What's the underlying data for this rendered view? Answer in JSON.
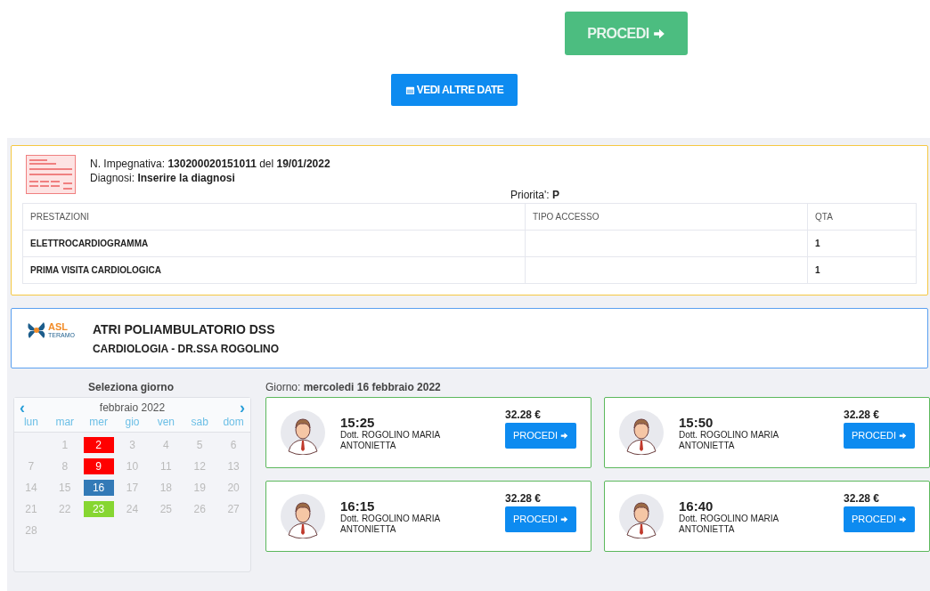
{
  "top_buttons": {
    "proceed": "PROCEDI",
    "other_dates": "VEDI ALTRE DATE"
  },
  "prescription": {
    "number_label": "N. Impegnativa:",
    "number": "130200020151011",
    "date_label": "del",
    "date": "19/01/2022",
    "diagnosis_label": "Diagnosi:",
    "diagnosis": "Inserire la diagnosi",
    "priority_label": "Priorita':",
    "priority": "P",
    "table": {
      "columns": [
        "PRESTAZIONI",
        "TIPO ACCESSO",
        "QTA"
      ],
      "rows": [
        [
          "ELETTROCARDIOGRAMMA",
          "",
          "1"
        ],
        [
          "PRIMA VISITA CARDIOLOGICA",
          "",
          "1"
        ]
      ]
    }
  },
  "facility": {
    "logo_text": "ASL",
    "logo_subtext": "TERAMO",
    "name": "ATRI POLIAMBULATORIO DSS",
    "department": "CARDIOLOGIA - DR.SSA ROGOLINO"
  },
  "calendar": {
    "title": "Seleziona giorno",
    "prev": "‹",
    "next": "›",
    "month": "febbraio 2022",
    "weekdays": [
      "lun",
      "mar",
      "mer",
      "gio",
      "ven",
      "sab",
      "dom"
    ],
    "first_week": [
      {
        "day": "1"
      },
      {
        "day": "2",
        "color": "#ff0000"
      },
      {
        "day": "3"
      },
      {
        "day": "4"
      },
      {
        "day": "5"
      },
      {
        "day": "6"
      }
    ],
    "weeks": [
      {
        "days": [
          {
            "day": "7"
          },
          {
            "day": "8"
          },
          {
            "day": "9",
            "color": "#ff0000"
          },
          {
            "day": "10"
          },
          {
            "day": "11"
          },
          {
            "day": "12"
          },
          {
            "day": "13"
          }
        ]
      },
      {
        "days": [
          {
            "day": "14"
          },
          {
            "day": "15"
          },
          {
            "day": "16",
            "color": "#337ab7"
          },
          {
            "day": "17"
          },
          {
            "day": "18"
          },
          {
            "day": "19"
          },
          {
            "day": "20"
          }
        ]
      },
      {
        "days": [
          {
            "day": "21"
          },
          {
            "day": "22"
          },
          {
            "day": "23",
            "color": "#86d632"
          },
          {
            "day": "24"
          },
          {
            "day": "25"
          },
          {
            "day": "26"
          },
          {
            "day": "27"
          }
        ]
      },
      {
        "days": [
          {
            "day": "28"
          }
        ]
      }
    ]
  },
  "slots": {
    "day_label": "Giorno:",
    "day": "mercoledi 16 febbraio 2022",
    "items": [
      {
        "time": "15:25",
        "doctor": "Dott. ROGOLINO MARIA ANTONIETTA",
        "price": "32.28 €",
        "button": "PROCEDI"
      },
      {
        "time": "15:50",
        "doctor": "Dott. ROGOLINO MARIA ANTONIETTA",
        "price": "32.28 €",
        "button": "PROCEDI"
      },
      {
        "time": "16:15",
        "doctor": "Dott. ROGOLINO MARIA ANTONIETTA",
        "price": "32.28 €",
        "button": "PROCEDI"
      },
      {
        "time": "16:40",
        "doctor": "Dott. ROGOLINO MARIA ANTONIETTA",
        "price": "32.28 €",
        "button": "PROCEDI"
      }
    ]
  }
}
